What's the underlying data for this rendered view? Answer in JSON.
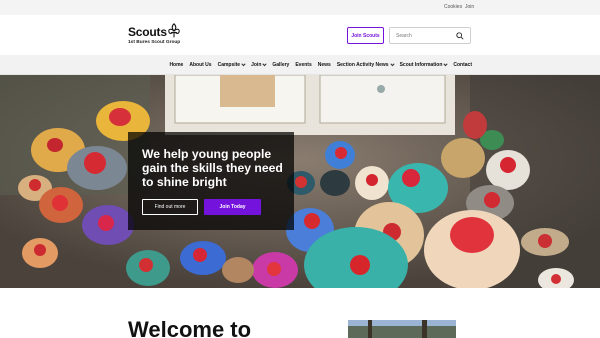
{
  "utility": {
    "cookies": "Cookies",
    "join": "Join"
  },
  "header": {
    "logo_word": "Scouts",
    "logo_sub": "1st Bures Scout Group",
    "join_button": "Join Scouts",
    "search_placeholder": "Search"
  },
  "nav": {
    "items": [
      {
        "label": "Home",
        "dropdown": false
      },
      {
        "label": "About Us",
        "dropdown": false
      },
      {
        "label": "Campsite",
        "dropdown": true
      },
      {
        "label": "Join",
        "dropdown": true
      },
      {
        "label": "Gallery",
        "dropdown": false
      },
      {
        "label": "Events",
        "dropdown": false
      },
      {
        "label": "News",
        "dropdown": false
      },
      {
        "label": "Section Activity News",
        "dropdown": true
      },
      {
        "label": "Scout Information",
        "dropdown": true
      },
      {
        "label": "Contact",
        "dropdown": false
      }
    ]
  },
  "hero": {
    "title": "We help young people gain the skills they need to shine bright",
    "find_out_more": "Find out more",
    "join_today": "Join Today"
  },
  "welcome": {
    "heading": "Welcome to"
  },
  "colors": {
    "brand_purple": "#7413dc",
    "nav_bg": "#f2f2f2"
  },
  "icons": {
    "logo": "fleur-de-lis-icon",
    "search": "search-icon",
    "dropdown": "chevron-down-icon"
  }
}
